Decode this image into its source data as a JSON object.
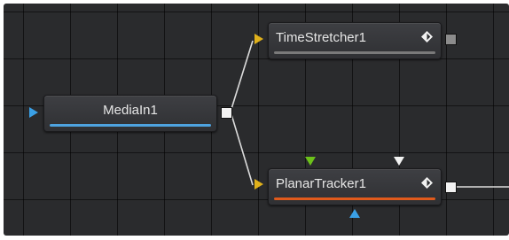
{
  "nodes": {
    "time_stretcher": {
      "label": "TimeStretcher1",
      "bar_color": "#7a7a7a",
      "input_color": "#e0b11b"
    },
    "media_in": {
      "label": "MediaIn1",
      "bar_color": "#4ea3e0",
      "input_color": "#3aa0e6"
    },
    "planar_tracker": {
      "label": "PlanarTracker1",
      "bar_color": "#e05a1c",
      "input_color": "#e0b11b",
      "top_input_left_color": "#6cc11a",
      "top_input_right_color": "#f2f2f2",
      "bottom_input_color": "#3aa0e6"
    }
  },
  "icons": {
    "keyframe": "keyframe-diamond-icon"
  },
  "colors": {
    "canvas": "#2a2b2d",
    "link": "#dcdcdc"
  }
}
